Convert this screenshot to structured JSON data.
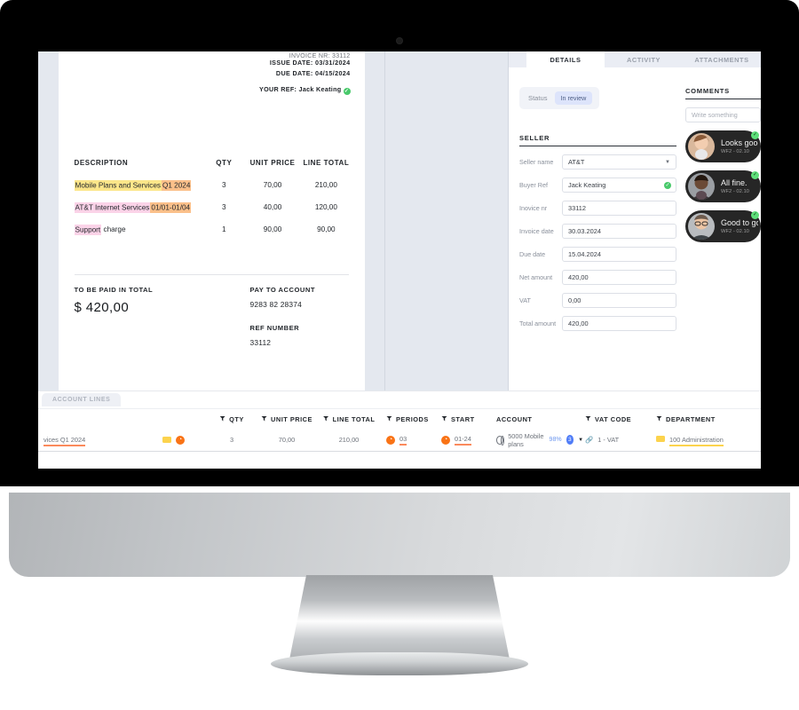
{
  "device": {
    "type": "desktop-monitor",
    "webcam": "camera-dot"
  },
  "invoice": {
    "cut_line": "INVOICE NR: 33112",
    "issue_date": "ISSUE DATE: 03/31/2024",
    "due_date": "DUE DATE: 04/15/2024",
    "your_ref": "YOUR REF: Jack Keating",
    "columns": {
      "description": "DESCRIPTION",
      "qty": "QTY",
      "unit_price": "UNIT PRICE",
      "line_total": "LINE TOTAL"
    },
    "lines": [
      {
        "desc_a": "Mobile Plans and Services",
        "desc_b": "Q1 2024",
        "qty": "3",
        "unit_price": "70,00",
        "line_total": "210,00"
      },
      {
        "desc_a": "AT&T Internet Services",
        "desc_b": "01/01-01/04",
        "qty": "3",
        "unit_price": "40,00",
        "line_total": "120,00"
      },
      {
        "desc_a": "Support",
        "desc_b": "charge",
        "qty": "1",
        "unit_price": "90,00",
        "line_total": "90,00"
      }
    ],
    "total_label": "TO BE PAID IN TOTAL",
    "total_amount": "$ 420,00",
    "pay_to_label": "PAY TO ACCOUNT",
    "pay_to_value": "9283 82 28374",
    "ref_number_label": "REF NUMBER",
    "ref_number_value": "33112"
  },
  "side": {
    "tabs": [
      {
        "label": "DETAILS",
        "active": true
      },
      {
        "label": "ACTIVITY",
        "active": false
      },
      {
        "label": "ATTACHMENTS",
        "active": false
      }
    ],
    "status_label": "Status",
    "status_value": "In review",
    "seller_title": "SELLER",
    "fields": [
      {
        "label": "Seller name",
        "value": "AT&T",
        "control": "dropdown"
      },
      {
        "label": "Buyer Ref",
        "value": "Jack Keating",
        "control": "verified"
      },
      {
        "label": "Inovice nr",
        "value": "33112",
        "control": "text"
      },
      {
        "label": "Invoice date",
        "value": "30.03.2024",
        "control": "text"
      },
      {
        "label": "Due date",
        "value": "15.04.2024",
        "control": "text"
      },
      {
        "label": "Net amount",
        "value": "420,00",
        "control": "text"
      },
      {
        "label": "VAT",
        "value": "0,00",
        "control": "text"
      },
      {
        "label": "Total amount",
        "value": "420,00",
        "control": "text"
      }
    ],
    "comments_title": "COMMENTS",
    "comment_placeholder": "Write something",
    "comments": [
      {
        "message": "Looks good",
        "meta": "WF2 - 02.10"
      },
      {
        "message": "All fine.",
        "meta": "WF2 - 02.10"
      },
      {
        "message": "Good to go",
        "meta": "WF2 - 02.10"
      }
    ]
  },
  "account_lines": {
    "tab_label": "ACCOUNT LINES",
    "columns": {
      "qty": "QTY",
      "unit_price": "UNIT PRICE",
      "line_total": "LINE TOTAL",
      "periods": "PERIODS",
      "start": "START",
      "account": "ACCOUNT",
      "vat_code": "VAT CODE",
      "department": "DEPARTMENT"
    },
    "row": {
      "description": "vices Q1 2024",
      "qty": "3",
      "unit_price": "70,00",
      "line_total": "210,00",
      "periods": "03",
      "start": "01-24",
      "account": "5000 Mobile plans",
      "split_pct": "98%",
      "split_count": "3",
      "vat_code": "1 - VAT",
      "department": "100 Administration"
    }
  },
  "colors": {
    "highlight_yellow": "#fce68a",
    "highlight_orange": "#fbc08a",
    "highlight_pink": "#fbd3e8",
    "accent_orange": "#f97316",
    "accent_blue": "#4f7cf7",
    "verified_green": "#49c96b",
    "panel_gray": "#e4e8ef"
  }
}
